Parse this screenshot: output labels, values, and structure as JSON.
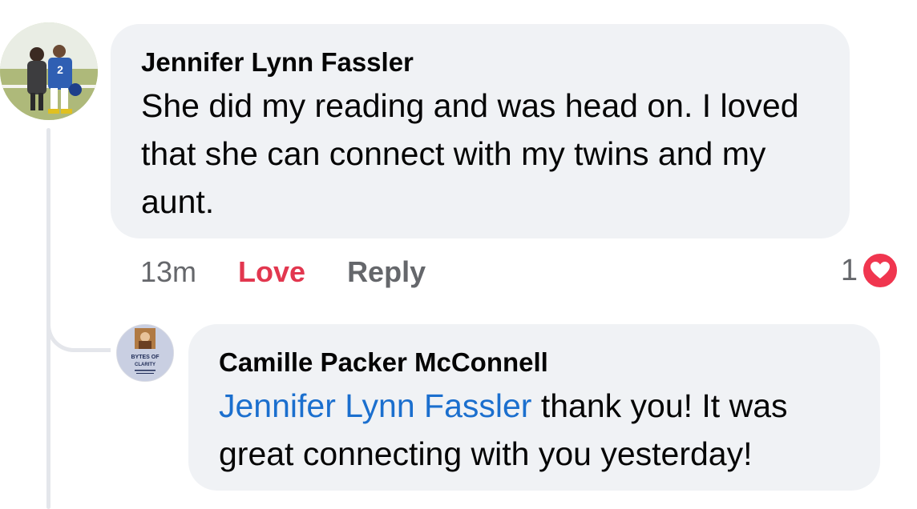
{
  "comment": {
    "author": "Jennifer Lynn Fassler",
    "text": "She did my reading and was head on. I loved that she can connect with my twins and my aunt.",
    "timestamp": "13m",
    "love_label": "Love",
    "reply_label": "Reply",
    "reaction_count": "1",
    "reaction_icon": "heart-icon",
    "reaction_color": "#f0364f"
  },
  "reply": {
    "author": "Camille Packer McConnell",
    "mention": "Jennifer Lynn Fassler",
    "text": " thank you! It was great connecting with you yesterday!",
    "mention_color": "#1b6fce",
    "avatar": {
      "logo_line1": "BYTES OF",
      "logo_line2": "CLARITY"
    }
  },
  "colors": {
    "bubble_bg": "#f0f2f5",
    "love": "#e2374f",
    "secondary_text": "#65676b"
  }
}
